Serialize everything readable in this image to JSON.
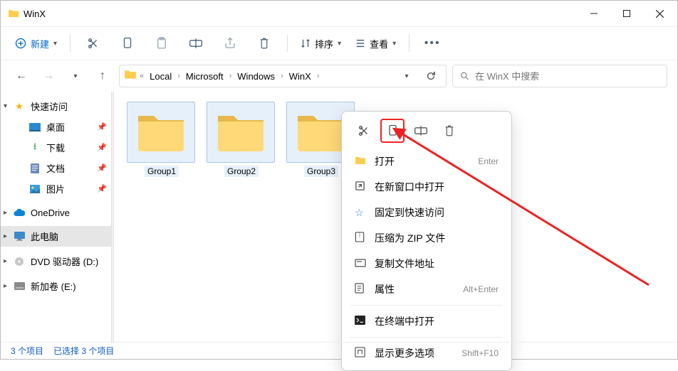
{
  "title": "WinX",
  "toolbar": {
    "new_label": "新建",
    "sort_label": "排序",
    "view_label": "查看"
  },
  "breadcrumb": {
    "ellipsis_label": "«",
    "segments": [
      "Local",
      "Microsoft",
      "Windows",
      "WinX"
    ]
  },
  "search": {
    "placeholder": "在 WinX 中搜索"
  },
  "sidebar": {
    "quick_access": "快速访问",
    "desktop": "桌面",
    "downloads": "下载",
    "documents": "文档",
    "pictures": "图片",
    "onedrive": "OneDrive",
    "this_pc": "此电脑",
    "dvd": "DVD 驱动器 (D:)",
    "volume": "新加卷 (E:)"
  },
  "folders": [
    {
      "name": "Group1"
    },
    {
      "name": "Group2"
    },
    {
      "name": "Group3"
    }
  ],
  "context_menu": {
    "open": "打开",
    "open_hint": "Enter",
    "open_new": "在新窗口中打开",
    "pin_quick": "固定到快速访问",
    "compress": "压缩为 ZIP 文件",
    "copy_path": "复制文件地址",
    "properties": "属性",
    "properties_hint": "Alt+Enter",
    "terminal": "在终端中打开",
    "more": "显示更多选项",
    "more_hint": "Shift+F10"
  },
  "status": {
    "items": "3 个项目",
    "selected": "已选择 3 个项目"
  }
}
